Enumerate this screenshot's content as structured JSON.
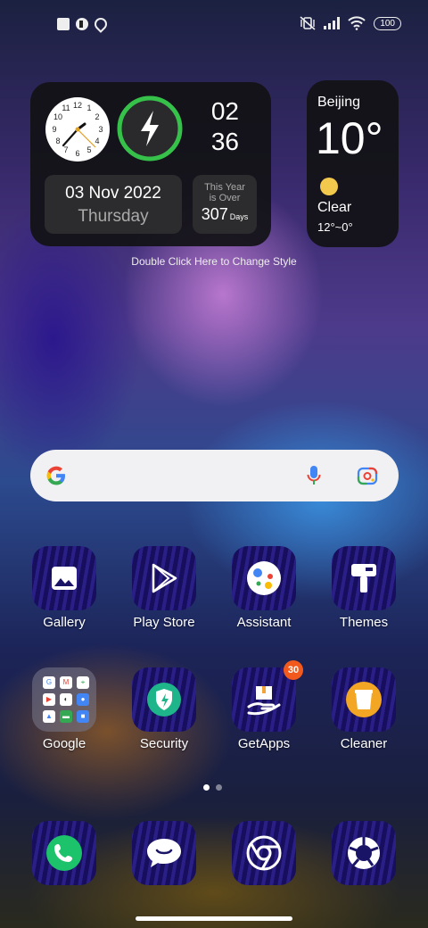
{
  "status_bar": {
    "battery": "100",
    "left_icons": [
      "screenshot-icon",
      "app-notification-icon",
      "location-icon"
    ],
    "right_icons": [
      "vibrate-off-icon",
      "signal-icon",
      "wifi-icon",
      "battery-icon"
    ]
  },
  "clock_widget": {
    "hour": "02",
    "minute": "36",
    "date": "03 Nov 2022",
    "weekday": "Thursday",
    "year_label_line1": "This Year",
    "year_label_line2": "is Over",
    "year_days": "307",
    "year_unit": "Days",
    "accent_color": "#36c24a"
  },
  "weather_widget": {
    "city": "Beijing",
    "temperature": "10°",
    "condition": "Clear",
    "range": "12°~0°"
  },
  "hint_text": "Double Click Here to Change Style",
  "search": {
    "icons": [
      "google-g-icon",
      "microphone-icon",
      "google-lens-icon"
    ]
  },
  "apps_row1": [
    {
      "label": "Gallery",
      "icon": "gallery-icon"
    },
    {
      "label": "Play Store",
      "icon": "play-store-icon"
    },
    {
      "label": "Assistant",
      "icon": "assistant-icon"
    },
    {
      "label": "Themes",
      "icon": "themes-icon"
    }
  ],
  "apps_row2": [
    {
      "label": "Google",
      "icon": "google-folder-icon"
    },
    {
      "label": "Security",
      "icon": "security-icon"
    },
    {
      "label": "GetApps",
      "icon": "getapps-icon",
      "badge": "30"
    },
    {
      "label": "Cleaner",
      "icon": "cleaner-icon"
    }
  ],
  "dock": [
    {
      "icon": "phone-icon"
    },
    {
      "icon": "messages-icon"
    },
    {
      "icon": "chrome-icon"
    },
    {
      "icon": "camera-icon"
    }
  ],
  "page_indicator": {
    "pages": 2,
    "active": 1
  }
}
